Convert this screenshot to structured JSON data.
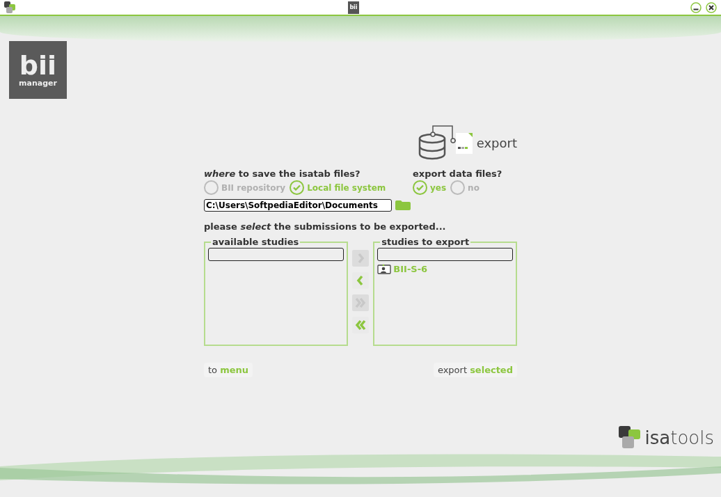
{
  "window": {
    "logo_text": "bii"
  },
  "brand": {
    "title": "bii",
    "subtitle": "manager"
  },
  "heading": "export",
  "destination": {
    "label": "*where* to save the isatab files?",
    "options": [
      {
        "label": "BII repository",
        "selected": false
      },
      {
        "label": "Local file system",
        "selected": true
      }
    ],
    "path": "C:\\Users\\SoftpediaEditor\\Documents"
  },
  "data_files": {
    "label": "export data files?",
    "options": [
      {
        "label": "yes",
        "selected": true
      },
      {
        "label": "no",
        "selected": false
      }
    ]
  },
  "instruction": "please *select* the submissions to be exported...",
  "available": {
    "title": "available studies"
  },
  "to_export": {
    "title": "studies to export",
    "items": [
      {
        "label": "BII-S-6"
      }
    ]
  },
  "transfer_buttons": [
    {
      "kind": "add",
      "disabled": true
    },
    {
      "kind": "remove",
      "disabled": false
    },
    {
      "kind": "add_all",
      "disabled": true
    },
    {
      "kind": "remove_all",
      "disabled": false
    }
  ],
  "footer": {
    "back": "to **menu**",
    "export": "export **selected**"
  },
  "footer_logo": "**isa**tools"
}
